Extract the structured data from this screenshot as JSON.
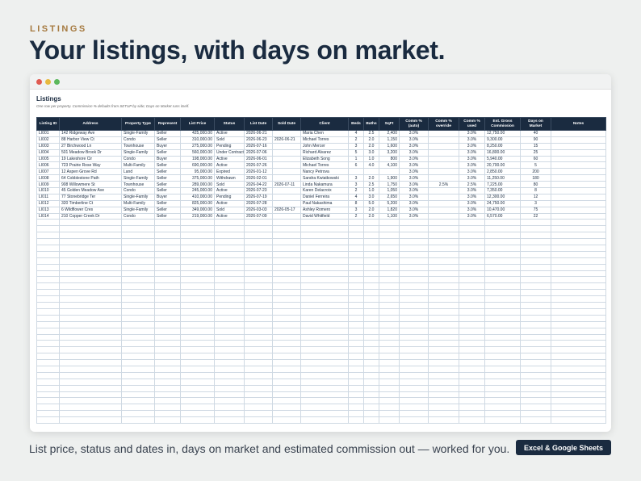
{
  "header": {
    "eyebrow": "LISTINGS",
    "headline": "Your listings, with days on market."
  },
  "window": {
    "dots": [
      "#e05b52",
      "#e7b93f",
      "#5cb85c"
    ]
  },
  "sheet": {
    "title": "Listings",
    "subtitle": "One row per property. Commission % defaults from SETUP by side; Days on Market runs itself.",
    "columns": [
      "Listing ID",
      "Address",
      "Property Type",
      "Represent",
      "List Price",
      "Status",
      "List Date",
      "Sold Date",
      "Client",
      "Beds",
      "Baths",
      "SqFt",
      "Comm % (auto)",
      "Comm % override",
      "Comm % used",
      "Est. Gross Commission",
      "Days on Market",
      "Notes"
    ],
    "rows": [
      [
        "LI001",
        "142 Ridgeway Ave",
        "Single-Family",
        "Seller",
        "425,000.00",
        "Active",
        "2026-06-21",
        "",
        "Maria Chen",
        "4",
        "2.5",
        "2,400",
        "3.0%",
        "",
        "3.0%",
        "12,750.00",
        "40",
        ""
      ],
      [
        "LI002",
        "88 Harbor View Ct",
        "Condo",
        "Seller",
        "310,000.00",
        "Sold",
        "2026-06-23",
        "2026-06-21",
        "Michael Torres",
        "2",
        "2.0",
        "1,150",
        "3.0%",
        "",
        "3.0%",
        "9,300.00",
        "90",
        ""
      ],
      [
        "LI003",
        "27 Birchwood Ln",
        "Townhouse",
        "Buyer",
        "275,000.00",
        "Pending",
        "2026-07-16",
        "",
        "John Mercer",
        "3",
        "2.0",
        "1,600",
        "3.0%",
        "",
        "3.0%",
        "8,250.00",
        "15",
        ""
      ],
      [
        "LI004",
        "501 Meadow Brook Dr",
        "Single-Family",
        "Seller",
        "560,000.00",
        "Under Contract",
        "2026-07-06",
        "",
        "Richard Alvarez",
        "5",
        "3.0",
        "3,200",
        "3.0%",
        "",
        "3.0%",
        "16,800.00",
        "25",
        ""
      ],
      [
        "LI005",
        "19 Lakeshore Cir",
        "Condo",
        "Buyer",
        "198,000.00",
        "Active",
        "2026-06-01",
        "",
        "Elizabeth Song",
        "1",
        "1.0",
        "800",
        "3.0%",
        "",
        "3.0%",
        "5,940.00",
        "60",
        ""
      ],
      [
        "LI006",
        "723 Prairie Rose Way",
        "Multi-Family",
        "Seller",
        "690,000.00",
        "Active",
        "2026-07-26",
        "",
        "Michael Torres",
        "6",
        "4.0",
        "4,100",
        "3.0%",
        "",
        "3.0%",
        "20,700.00",
        "5",
        ""
      ],
      [
        "LI007",
        "12 Aspen Grove Rd",
        "Land",
        "Seller",
        "95,000.00",
        "Expired",
        "2026-01-12",
        "",
        "Nancy Petrova",
        "",
        "",
        "",
        "3.0%",
        "",
        "3.0%",
        "2,850.00",
        "200",
        ""
      ],
      [
        "LI008",
        "64 Cobblestone Path",
        "Single-Family",
        "Seller",
        "375,000.00",
        "Withdrawn",
        "2026-02-01",
        "",
        "Sandra Kwiatkowski",
        "3",
        "2.0",
        "1,900",
        "3.0%",
        "",
        "3.0%",
        "11,250.00",
        "180",
        ""
      ],
      [
        "LI009",
        "908 Willowmere St",
        "Townhouse",
        "Seller",
        "289,000.00",
        "Sold",
        "2026-04-22",
        "2026-07-11",
        "Linda Nakamura",
        "3",
        "2.5",
        "1,750",
        "3.0%",
        "2.5%",
        "2.5%",
        "7,225.00",
        "80",
        ""
      ],
      [
        "LI010",
        "45 Golden Meadow Ave",
        "Condo",
        "Seller",
        "245,000.00",
        "Active",
        "2026-07-23",
        "",
        "Karen Delacroix",
        "2",
        "1.0",
        "1,050",
        "3.0%",
        "",
        "3.0%",
        "7,350.00",
        "8",
        ""
      ],
      [
        "LI011",
        "77 Stonebridge Ter",
        "Single-Family",
        "Buyer",
        "410,000.00",
        "Pending",
        "2026-07-19",
        "",
        "Daniel Ferreira",
        "4",
        "3.0",
        "2,650",
        "3.0%",
        "",
        "3.0%",
        "12,300.00",
        "12",
        ""
      ],
      [
        "LI012",
        "320 Timberline Ct",
        "Multi-Family",
        "Seller",
        "825,000.00",
        "Active",
        "2026-07-28",
        "",
        "Paul Nakashima",
        "8",
        "5.0",
        "5,200",
        "3.0%",
        "",
        "3.0%",
        "24,750.00",
        "3",
        ""
      ],
      [
        "LI013",
        "6 Wildflower Cres",
        "Single-Family",
        "Seller",
        "349,000.00",
        "Sold",
        "2026-03-03",
        "2026-05-17",
        "Ashley Romero",
        "3",
        "2.0",
        "1,820",
        "3.0%",
        "",
        "3.0%",
        "10,470.00",
        "75",
        ""
      ],
      [
        "LI014",
        "210 Copper Creek Dr",
        "Condo",
        "Seller",
        "219,000.00",
        "Active",
        "2026-07-09",
        "",
        "David Whitfield",
        "2",
        "2.0",
        "1,100",
        "3.0%",
        "",
        "3.0%",
        "6,570.00",
        "22",
        ""
      ]
    ],
    "empty_rows": 32
  },
  "footer": {
    "caption": "List price, status and dates in, days on market and estimated commission out — worked for you.",
    "badge": "Excel & Google Sheets"
  }
}
